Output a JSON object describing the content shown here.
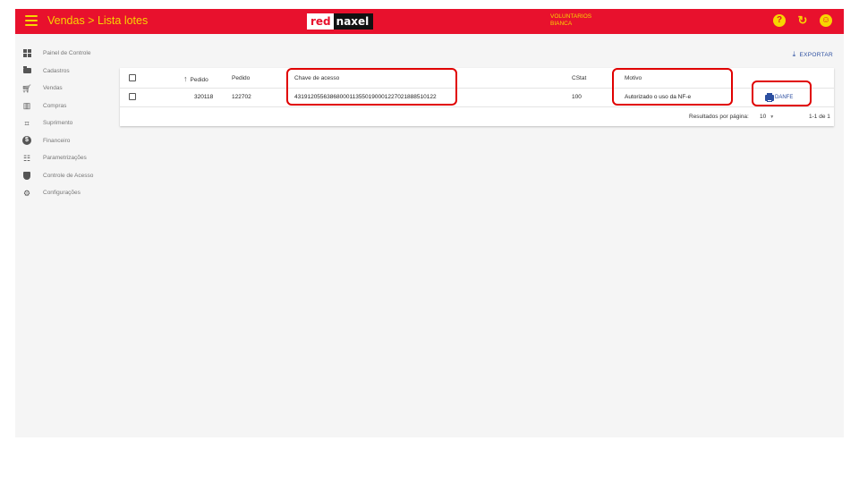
{
  "header": {
    "title": "Vendas > Lista lotes",
    "logo": {
      "part1": "red",
      "part2": "naxel"
    },
    "user": {
      "line1": "VOLUNTARIOS",
      "line2": "BIANCA"
    },
    "icons": {
      "menu": "menu-icon",
      "help": "help-icon",
      "refresh": "refresh-icon",
      "account": "account-icon"
    }
  },
  "sidebar": {
    "items": [
      {
        "label": "Painel de Controle",
        "icon": "dashboard-icon"
      },
      {
        "label": "Cadastros",
        "icon": "folder-icon"
      },
      {
        "label": "Vendas",
        "icon": "cart-icon"
      },
      {
        "label": "Compras",
        "icon": "store-icon"
      },
      {
        "label": "Suprimento",
        "icon": "inventory-icon"
      },
      {
        "label": "Financeiro",
        "icon": "money-icon"
      },
      {
        "label": "Parametrizações",
        "icon": "tune-icon"
      },
      {
        "label": "Controle de Acesso",
        "icon": "shield-icon"
      },
      {
        "label": "Configurações",
        "icon": "gear-icon"
      }
    ]
  },
  "main": {
    "export_label": "EXPORTAR",
    "table": {
      "headers": {
        "pedido_sorted": "Pedido",
        "pedido": "Pedido",
        "chave": "Chave de acesso",
        "cstat": "CStat",
        "motivo": "Motivo"
      },
      "rows": [
        {
          "pedido_a": "320118",
          "pedido_b": "122702",
          "chave": "43191205563868000113550190001227021888510122",
          "cstat": "100",
          "motivo": "Autorizado o uso da NF-e",
          "action": "DANFE"
        }
      ],
      "footer": {
        "rows_per_page_label": "Resultados por página:",
        "rows_per_page": "10",
        "range": "1-1 de 1"
      }
    }
  },
  "colors": {
    "header_bg": "#e8112d",
    "header_text": "#f7d600",
    "link_blue": "#2c4fa0",
    "annotation_red": "#e00000"
  }
}
